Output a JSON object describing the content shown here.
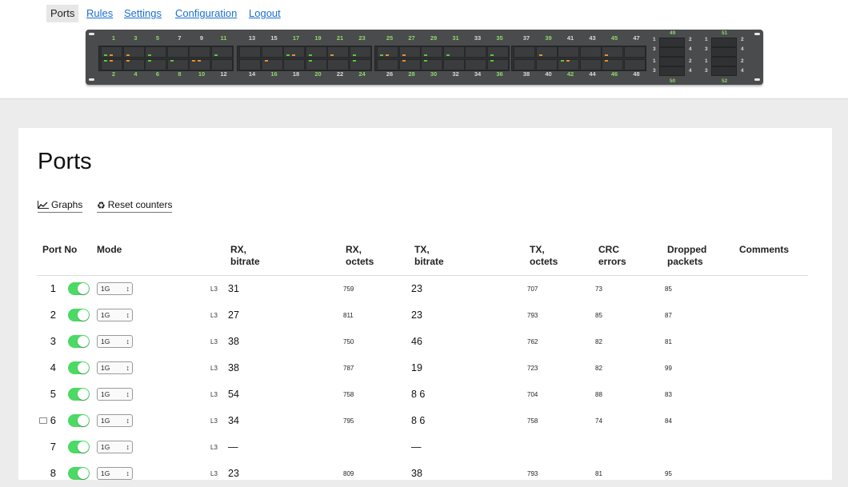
{
  "nav": {
    "items": [
      {
        "label": "Ports",
        "active": true
      },
      {
        "label": "Rules"
      },
      {
        "label": "Settings"
      },
      {
        "label": "Configuration"
      },
      {
        "label": "Logout"
      }
    ]
  },
  "panel": {
    "colors": {
      "link_up": "#8fd66a",
      "link_down": "#d8d8d8",
      "led_green": "#5ac83a",
      "led_orange": "#e7902c"
    },
    "top_ports": [
      "1",
      "3",
      "5",
      "7",
      "9",
      "11",
      "13",
      "15",
      "17",
      "19",
      "21",
      "23",
      "25",
      "27",
      "29",
      "31",
      "33",
      "35",
      "37",
      "39",
      "41",
      "43",
      "45",
      "47"
    ],
    "bottom_ports": [
      "2",
      "4",
      "6",
      "8",
      "10",
      "12",
      "14",
      "16",
      "18",
      "20",
      "22",
      "24",
      "26",
      "28",
      "30",
      "32",
      "34",
      "36",
      "38",
      "40",
      "42",
      "44",
      "46",
      "48"
    ],
    "top_up": [
      true,
      true,
      true,
      false,
      false,
      true,
      false,
      false,
      true,
      true,
      true,
      true,
      true,
      true,
      true,
      true,
      false,
      true,
      false,
      true,
      false,
      false,
      true,
      false
    ],
    "bottom_up": [
      true,
      true,
      true,
      true,
      true,
      false,
      false,
      true,
      false,
      true,
      false,
      true,
      false,
      true,
      true,
      false,
      false,
      true,
      false,
      false,
      true,
      false,
      true,
      false
    ],
    "sfp_groups": [
      {
        "label_top": "49",
        "label_bottom": "50",
        "left_nums": [
          "1",
          "3",
          "1",
          "3"
        ],
        "right_nums": [
          "2",
          "4",
          "2",
          "4"
        ]
      },
      {
        "label_top": "51",
        "label_bottom": "52",
        "left_nums": [
          "1",
          "3",
          "1",
          "3"
        ],
        "right_nums": [
          "2",
          "4",
          "2",
          "4"
        ]
      }
    ]
  },
  "page": {
    "title": "Ports",
    "actions": {
      "graphs": "Graphs",
      "reset": "Reset counters"
    }
  },
  "table": {
    "headers": {
      "port_no": "Port No",
      "mode": "Mode",
      "rx_bitrate_1": "RX,",
      "rx_bitrate_2": "bitrate",
      "rx_octets_1": "RX,",
      "rx_octets_2": "octets",
      "tx_bitrate_1": "TX,",
      "tx_bitrate_2": "bitrate",
      "tx_octets_1": "TX,",
      "tx_octets_2": "octets",
      "crc_1": "CRC",
      "crc_2": "errors",
      "dropped_1": "Dropped",
      "dropped_2": "packets",
      "comments": "Comments"
    },
    "rows": [
      {
        "port": "1",
        "mode": "1G",
        "layer": "L3",
        "rx_bitrate": "31",
        "rx_octets": "759",
        "tx_bitrate": "23",
        "tx_octets": "707",
        "crc": "73",
        "dropped": "85"
      },
      {
        "port": "2",
        "mode": "1G",
        "layer": "L3",
        "rx_bitrate": "27",
        "rx_octets": "811",
        "tx_bitrate": "23",
        "tx_octets": "793",
        "crc": "85",
        "dropped": "87"
      },
      {
        "port": "3",
        "mode": "1G",
        "layer": "L3",
        "rx_bitrate": "38",
        "rx_octets": "750",
        "tx_bitrate": "46",
        "tx_octets": "762",
        "crc": "82",
        "dropped": "81"
      },
      {
        "port": "4",
        "mode": "1G",
        "layer": "L3",
        "rx_bitrate": "38",
        "rx_octets": "787",
        "tx_bitrate": "19",
        "tx_octets": "723",
        "crc": "82",
        "dropped": "99"
      },
      {
        "port": "5",
        "mode": "1G",
        "layer": "L3",
        "rx_bitrate": "54",
        "rx_octets": "758",
        "tx_bitrate": "8 6",
        "tx_octets": "704",
        "crc": "88",
        "dropped": "83"
      },
      {
        "port": "6",
        "mode": "1G",
        "layer": "L3",
        "rx_bitrate": "34",
        "rx_octets": "795",
        "tx_bitrate": "8 6",
        "tx_octets": "758",
        "crc": "74",
        "dropped": "84",
        "icon": "keyboard-icon"
      },
      {
        "port": "7",
        "mode": "1G",
        "layer": "L3",
        "rx_bitrate": "—",
        "rx_octets": "",
        "tx_bitrate": "—",
        "tx_octets": "",
        "crc": "",
        "dropped": ""
      },
      {
        "port": "8",
        "mode": "1G",
        "layer": "L3",
        "rx_bitrate": "23",
        "rx_octets": "809",
        "tx_bitrate": "38",
        "tx_octets": "793",
        "crc": "81",
        "dropped": "95"
      }
    ]
  }
}
